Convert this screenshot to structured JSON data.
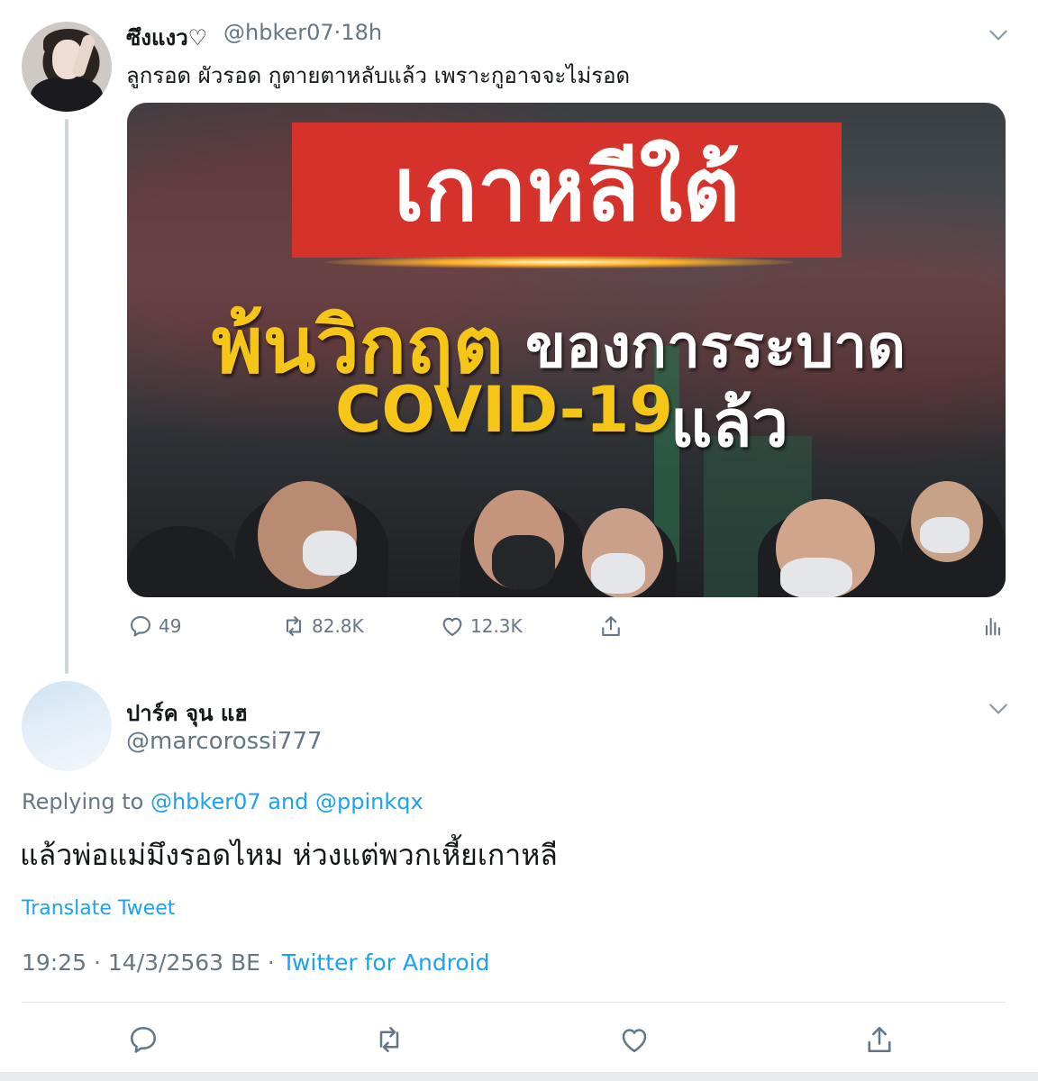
{
  "tweet1": {
    "display_name": "ซึงแงว♡",
    "handle": "@hbker07",
    "separator": "·",
    "time": "18h",
    "text": "ลูกรอด ผัวรอด กูตายตาหลับแล้ว เพราะกูอาจจะไม่รอด",
    "media": {
      "headline": "เกาหลีใต้",
      "line2_highlight": "พ้นวิกฤต",
      "line2_rest": "ของการระบาด",
      "line3_highlight": "COVID-19",
      "line3_rest": "แล้ว"
    },
    "actions": {
      "reply_count": "49",
      "retweet_count": "82.8K",
      "like_count": "12.3K"
    }
  },
  "tweet2": {
    "display_name": "ปาร์ค จุน แฮ",
    "handle": "@marcorossi777",
    "replying_prefix": "Replying to",
    "replying_to": "@hbker07 and @ppinkqx",
    "text": "แล้วพ่อแม่มึงรอดไหม ห่วงแต่พวกเหี้ยเกาหลี",
    "translate_label": "Translate Tweet",
    "timestamp": "19:25 · 14/3/2563 BE ·",
    "source": "Twitter for Android"
  },
  "icons": {
    "reply": "reply-icon",
    "retweet": "retweet-icon",
    "like": "heart-icon",
    "share": "share-icon",
    "analytics": "analytics-icon",
    "more": "chevron-down-icon"
  },
  "colors": {
    "link": "#1da1f2",
    "muted": "#657786",
    "thread_line": "#ccd6dd",
    "banner_red": "#d5322b",
    "headline_yellow": "#f5c518"
  }
}
